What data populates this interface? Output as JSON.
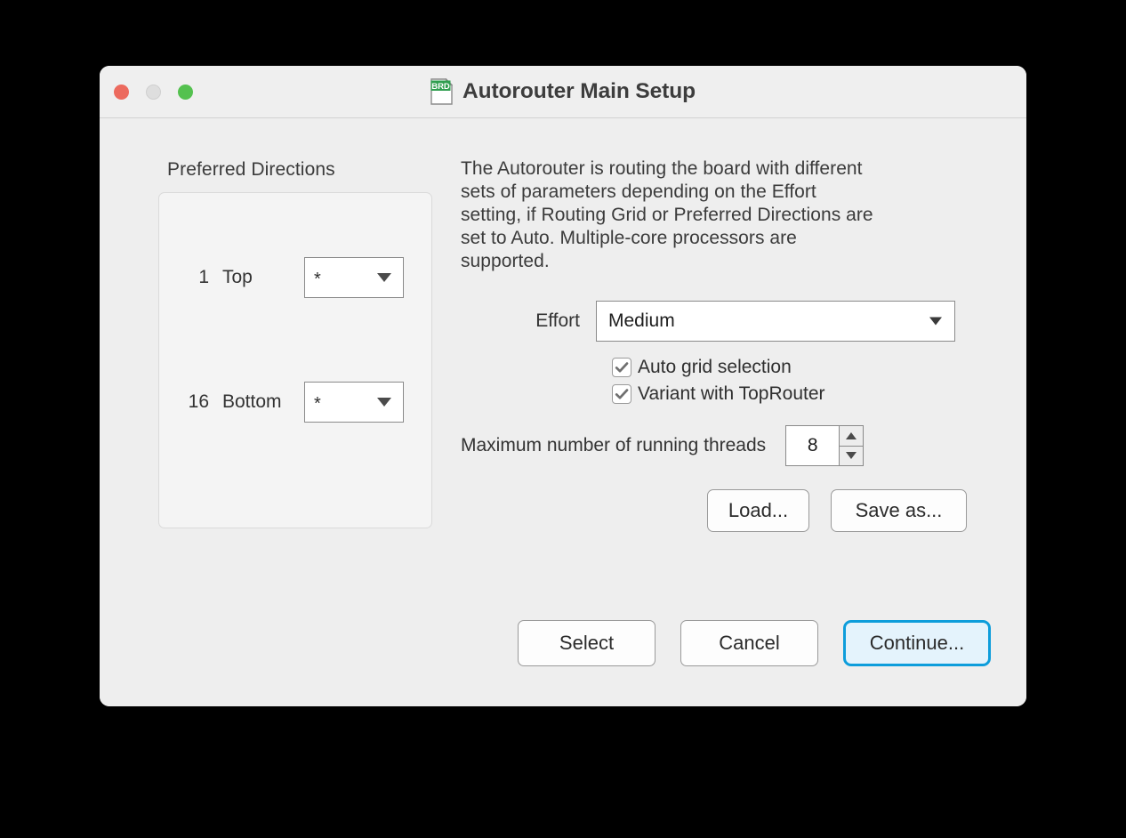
{
  "window": {
    "title": "Autorouter Main Setup",
    "icon": "brd-document-icon",
    "icon_label": "BRD",
    "traffic_lights": [
      {
        "name": "close",
        "color": "#ec6a5e"
      },
      {
        "name": "minimize",
        "color": "#dedede"
      },
      {
        "name": "maximize",
        "color": "#54c14f"
      }
    ]
  },
  "preferred_directions": {
    "title": "Preferred Directions",
    "layers": [
      {
        "number": "1",
        "name": "Top",
        "direction": "*"
      },
      {
        "number": "16",
        "name": "Bottom",
        "direction": "*"
      }
    ]
  },
  "description": "The Autorouter is routing the board with different sets of parameters depending on the Effort setting, if Routing Grid or Preferred Directions are set to Auto. Multiple-core processors are supported.",
  "effort": {
    "label": "Effort",
    "value": "Medium"
  },
  "checkboxes": [
    {
      "label": "Auto grid selection",
      "checked": true
    },
    {
      "label": "Variant with TopRouter",
      "checked": true
    }
  ],
  "threads": {
    "label": "Maximum number of running threads",
    "value": "8"
  },
  "preset_buttons": {
    "load": "Load...",
    "save_as": "Save as..."
  },
  "footer_buttons": {
    "select": "Select",
    "cancel": "Cancel",
    "continue": "Continue..."
  },
  "colors": {
    "accent": "#0d9ddb",
    "accent_fill": "#e4f3fc",
    "window_bg": "#eeeeee",
    "icon_green": "#2f9e4f"
  }
}
